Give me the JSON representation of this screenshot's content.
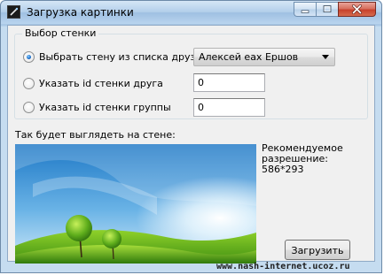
{
  "window": {
    "title": "Загрузка картинки"
  },
  "group": {
    "legend": "Выбор стенки",
    "options": [
      {
        "label": "Выбрать стену из списка друзей",
        "checked": true
      },
      {
        "label": "Указать id стенки друга",
        "checked": false
      },
      {
        "label": "Указать id стенки группы",
        "checked": false
      }
    ],
    "friend_select": {
      "value": "Алексей еах Ершов"
    },
    "friend_id": {
      "value": "0"
    },
    "group_id": {
      "value": "0"
    }
  },
  "preview": {
    "label": "Так будет выглядеть на стене:",
    "resolution_label": "Рекомендуемое разрешение:",
    "resolution_value": "586*293"
  },
  "upload_button": {
    "label": "Загрузить"
  },
  "watermark": "www.nash-internet.ucoz.ru",
  "icons": [
    "app-icon",
    "minimize-icon",
    "maximize-icon",
    "close-icon",
    "dropdown-arrow-icon"
  ]
}
